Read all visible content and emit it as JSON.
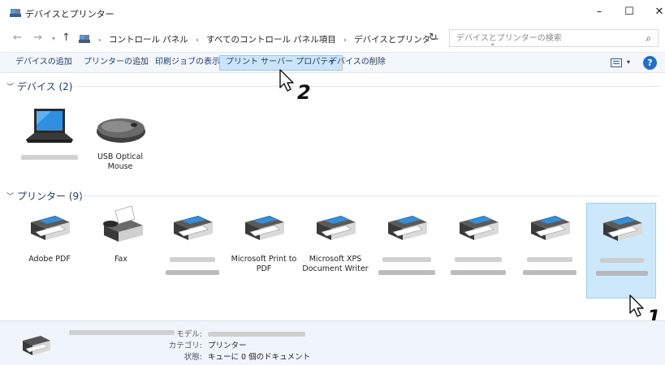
{
  "window": {
    "title": "デバイスとプリンター",
    "controls": {
      "minimize": "–",
      "maximize": "☐",
      "close": "✕"
    }
  },
  "address": {
    "breadcrumbs": [
      "コントロール パネル",
      "すべてのコントロール パネル項目",
      "デバイスとプリンター"
    ],
    "search_placeholder": "デバイスとプリンターの検索"
  },
  "commands": [
    {
      "label": "デバイスの追加"
    },
    {
      "label": "プリンターの追加"
    },
    {
      "label": "印刷ジョブの表示"
    },
    {
      "label": "プリント サーバー プロパティ",
      "active": true
    },
    {
      "label": "デバイスの削除"
    }
  ],
  "groups": {
    "devices": {
      "title": "デバイス (2)",
      "items": [
        {
          "name": "",
          "blurred": true
        },
        {
          "name": "USB Optical\nMouse"
        }
      ]
    },
    "printers": {
      "title": "プリンター (9)",
      "items": [
        {
          "name": "Adobe PDF"
        },
        {
          "name": "Fax"
        },
        {
          "name": "",
          "blurred": true
        },
        {
          "name": "Microsoft Print to PDF"
        },
        {
          "name": "Microsoft XPS Document Writer"
        },
        {
          "name": "",
          "blurred": true
        },
        {
          "name": "",
          "blurred": true
        },
        {
          "name": "",
          "blurred": true
        },
        {
          "name": "",
          "blurred": true,
          "selected": true
        }
      ]
    }
  },
  "details": {
    "model_label": "モデル:",
    "category_label": "カテゴリ:",
    "category_value": "プリンター",
    "status_label": "状態:",
    "status_value": "キューに 0 個のドキュメント"
  },
  "annotations": {
    "step1": "1",
    "step2": "2"
  },
  "colors": {
    "accent": "#1e3d70",
    "selection": "#cde8fb",
    "command_active": "#cce4f7",
    "help": "#1f6fd1"
  }
}
